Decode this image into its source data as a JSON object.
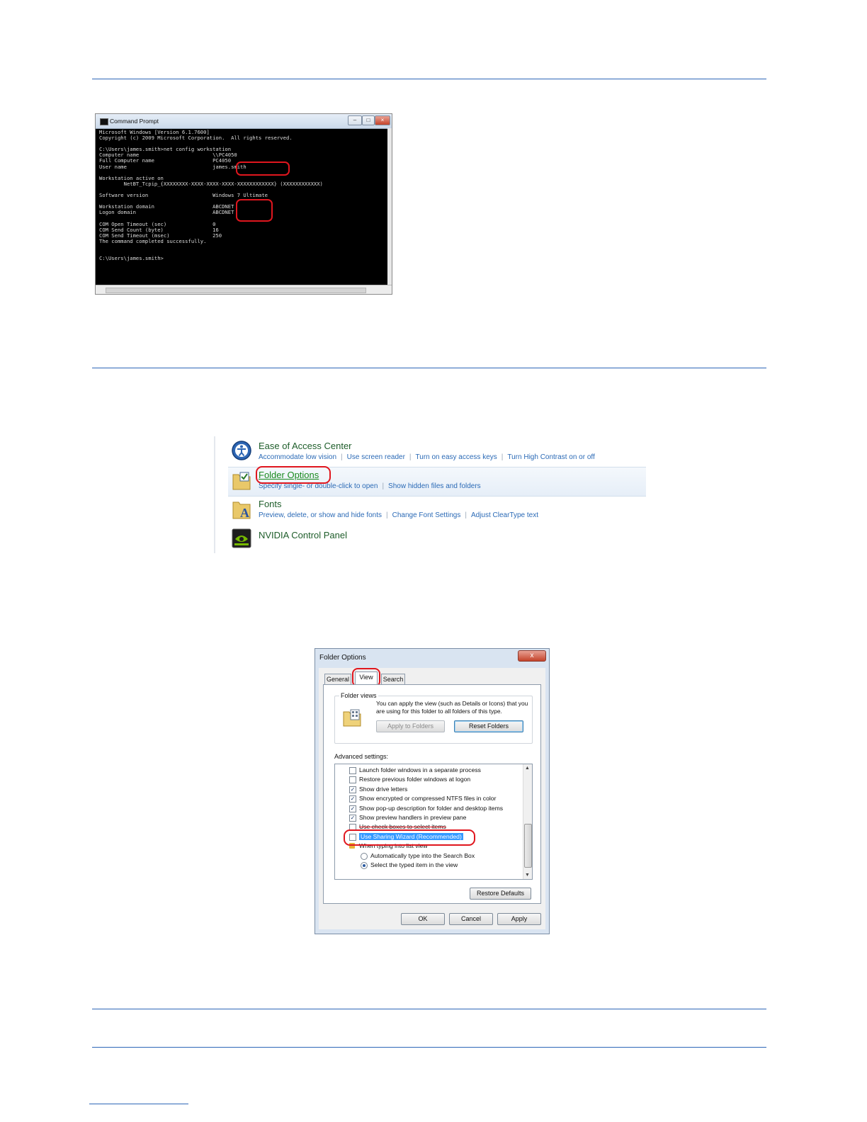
{
  "cmd": {
    "title": "Command Prompt",
    "lines": [
      "Microsoft Windows [Version 6.1.7600]",
      "Copyright (c) 2009 Microsoft Corporation.  All rights reserved.",
      "",
      "C:\\Users\\james.smith>net config workstation",
      "Computer name                        \\\\PC4050",
      "Full Computer name                   PC4050",
      "User name                            james.smith",
      "",
      "Workstation active on",
      "        NetBT_Tcpip_{XXXXXXXX-XXXX-XXXX-XXXX-XXXXXXXXXXXX} (XXXXXXXXXXXX)",
      "",
      "Software version                     Windows 7 Ultimate",
      "",
      "Workstation domain                   ABCDNET",
      "Logon domain                         ABCDNET",
      "",
      "COM Open Timeout (sec)               0",
      "COM Send Count (byte)                16",
      "COM Send Timeout (msec)              250",
      "The command completed successfully.",
      "",
      "",
      "C:\\Users\\james.smith>"
    ]
  },
  "control_panel": {
    "items": [
      {
        "title": "Ease of Access Center",
        "links": [
          "Accommodate low vision",
          "Use screen reader",
          "Turn on easy access keys",
          "Turn High Contrast on or off"
        ]
      },
      {
        "title": "Folder Options",
        "links": [
          "Specify single- or double-click to open",
          "Show hidden files and folders"
        ]
      },
      {
        "title": "Fonts",
        "links": [
          "Preview, delete, or show and hide fonts",
          "Change Font Settings",
          "Adjust ClearType text"
        ]
      },
      {
        "title": "NVIDIA Control Panel",
        "links": []
      }
    ]
  },
  "folder_options": {
    "title": "Folder Options",
    "close": "x",
    "tabs": [
      "General",
      "View",
      "Search"
    ],
    "folder_views": {
      "legend": "Folder views",
      "description": "You can apply the view (such as Details or Icons) that you are using for this folder to all folders of this type.",
      "apply_button": "Apply to Folders",
      "reset_button": "Reset Folders"
    },
    "advanced_label": "Advanced settings:",
    "settings": [
      {
        "label": "Launch folder windows in a separate process",
        "checked": false
      },
      {
        "label": "Restore previous folder windows at logon",
        "checked": false
      },
      {
        "label": "Show drive letters",
        "checked": true
      },
      {
        "label": "Show encrypted or compressed NTFS files in color",
        "checked": true
      },
      {
        "label": "Show pop-up description for folder and desktop items",
        "checked": true
      },
      {
        "label": "Show preview handlers in preview pane",
        "checked": true
      },
      {
        "label": "Use check boxes to select items",
        "checked": false
      },
      {
        "label": "Use Sharing Wizard (Recommended)",
        "checked": false
      },
      {
        "label": "When typing into list view",
        "checked": null
      },
      {
        "label": "Automatically type into the Search Box",
        "radio": false
      },
      {
        "label": "Select the typed item in the view",
        "radio": true
      }
    ],
    "restore_defaults": "Restore Defaults",
    "ok": "OK",
    "cancel": "Cancel",
    "apply": "Apply"
  },
  "colors": {
    "accent_rule": "#2e67b8",
    "highlight": "#e0161e",
    "link": "#2b6ab6",
    "cp_title": "#1e5d2a"
  }
}
